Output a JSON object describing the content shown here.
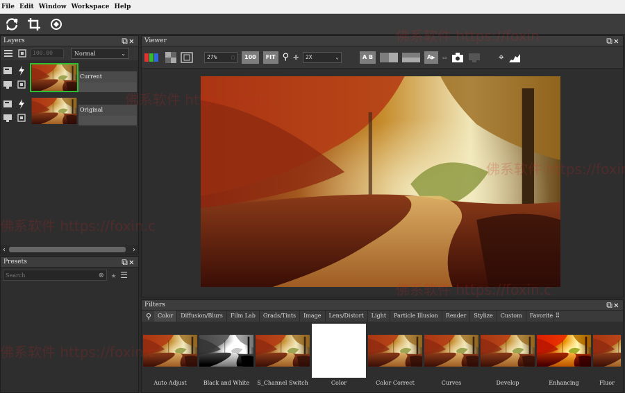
{
  "menu": [
    "File",
    "Edit",
    "Window",
    "Workspace",
    "Help"
  ],
  "panels": {
    "layers_title": "Layers",
    "viewer_title": "Viewer",
    "presets_title": "Presets",
    "filters_title": "Filters"
  },
  "layers": {
    "opacity": "100.00",
    "blend_mode": "Normal",
    "items": [
      {
        "name": "Current",
        "selected": true
      },
      {
        "name": "Original",
        "selected": false
      }
    ]
  },
  "presets": {
    "search_placeholder": "Search"
  },
  "viewer": {
    "zoom": "27%",
    "btn_100": "100",
    "btn_fit": "FIT",
    "zoom2": "2X",
    "btn_ab": "A B",
    "btn_a": "A"
  },
  "filters": {
    "tabs": [
      "Color",
      "Diffusion/Blurs",
      "Film Lab",
      "Grads/Tints",
      "Image",
      "Lens/Distort",
      "Light",
      "Particle Illusion",
      "Render",
      "Stylize",
      "Custom",
      "Favorites"
    ],
    "items": [
      "Auto Adjust",
      "Black and White",
      "S_Channel Switch",
      "Color",
      "Color Correct",
      "Curves",
      "Develop",
      "Enhancing",
      "Fluor"
    ]
  },
  "watermarks": [
    "佛系软件 https://foxin",
    "佛系软件 https://foxin",
    "佛系软件 https://foxin.c",
    "佛系软件 https://foxin.c",
    "佛系软件 https://foxin.c",
    "佛系软件 https://foxin.c"
  ],
  "colors": {
    "selection": "#2fc02f",
    "panel": "#2e2e2e",
    "menubar": "#f0f0f0"
  }
}
